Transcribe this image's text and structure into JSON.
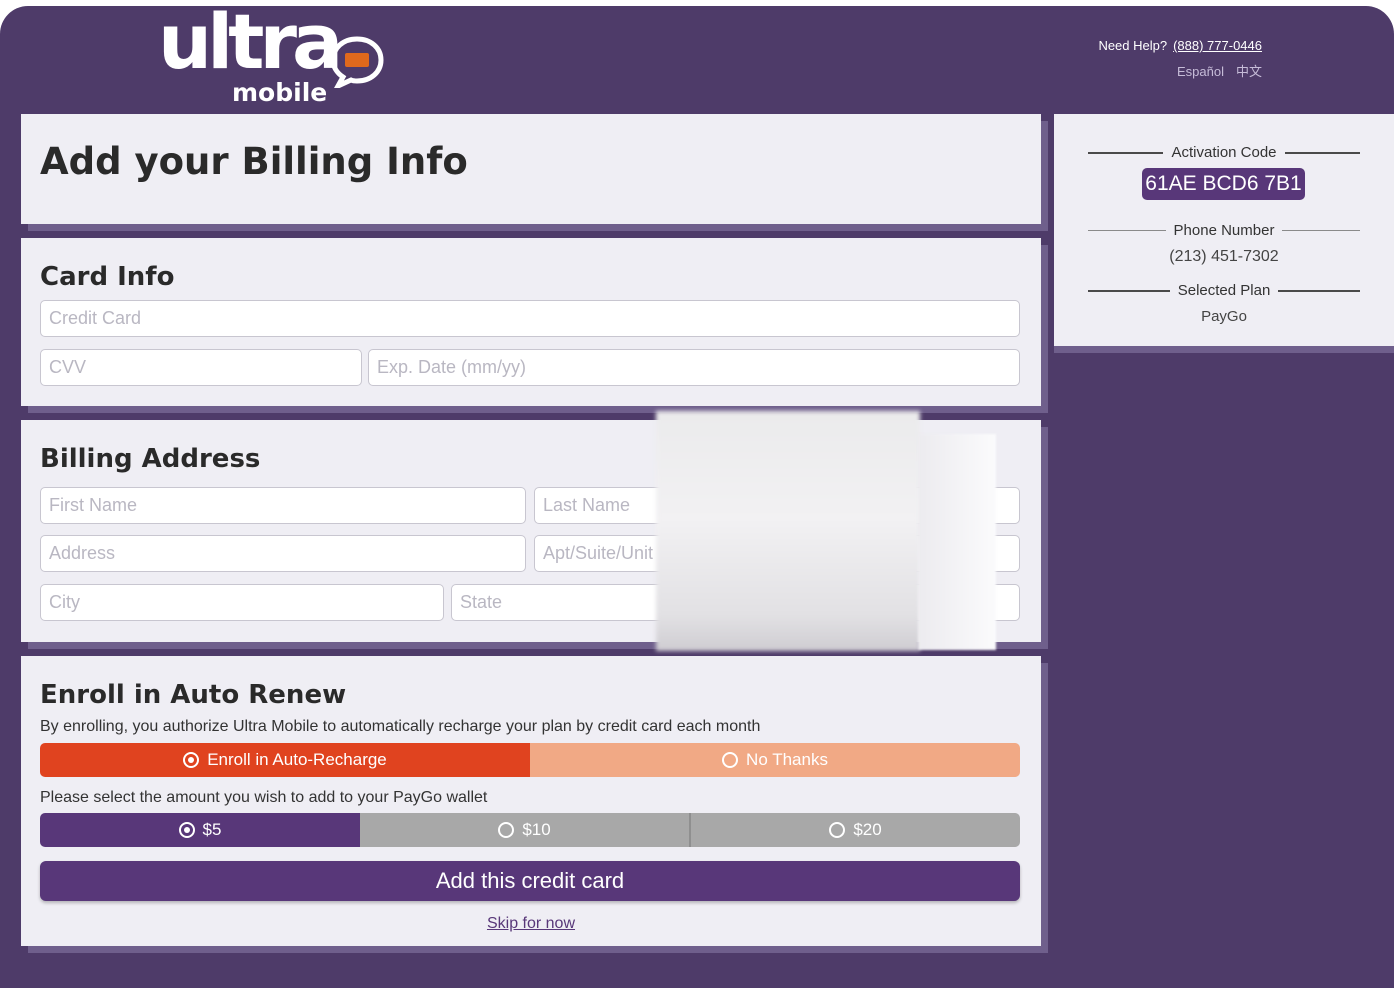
{
  "header": {
    "logo_main": "ultra",
    "logo_sub": "mobile",
    "help_label": "Need Help?",
    "help_phone": "(888) 777-0446",
    "languages": [
      "Español",
      "中文"
    ]
  },
  "page_title": "Add your Billing Info",
  "card_info": {
    "heading": "Card Info",
    "credit_card_placeholder": "Credit Card",
    "cvv_placeholder": "CVV",
    "exp_placeholder": "Exp. Date (mm/yy)"
  },
  "billing": {
    "heading": "Billing Address",
    "first_name_placeholder": "First Name",
    "last_name_placeholder": "Last Name",
    "address_placeholder": "Address",
    "apt_placeholder": "Apt/Suite/Unit",
    "city_placeholder": "City",
    "state_placeholder": "State"
  },
  "auto_renew": {
    "heading": "Enroll in Auto Renew",
    "description": "By enrolling, you authorize Ultra Mobile to automatically recharge your plan by credit card each month",
    "options": [
      {
        "label": "Enroll in Auto-Recharge",
        "selected": true
      },
      {
        "label": "No Thanks",
        "selected": false
      }
    ],
    "amount_prompt": "Please select the amount you wish to add to your PayGo wallet",
    "amounts": [
      {
        "label": "$5",
        "selected": true
      },
      {
        "label": "$10",
        "selected": false
      },
      {
        "label": "$20",
        "selected": false
      }
    ],
    "submit_label": "Add this credit card",
    "skip_label": "Skip for now"
  },
  "summary": {
    "activation_label": "Activation Code",
    "activation_code": "61AE BCD6 7B1",
    "phone_label": "Phone Number",
    "phone_value": "(213) 451-7302",
    "plan_label": "Selected Plan",
    "plan_value": "PayGo"
  },
  "colors": {
    "background": "#4e3b69",
    "card": "#efeef4",
    "primary_purple": "#583779",
    "enroll_selected": "#e0431f",
    "enroll_unselected": "#f1a985",
    "amount_unselected": "#a8a8a8"
  },
  "icons": [
    "chat-bubble-logo-icon",
    "radio-selected-icon",
    "radio-unselected-icon"
  ]
}
